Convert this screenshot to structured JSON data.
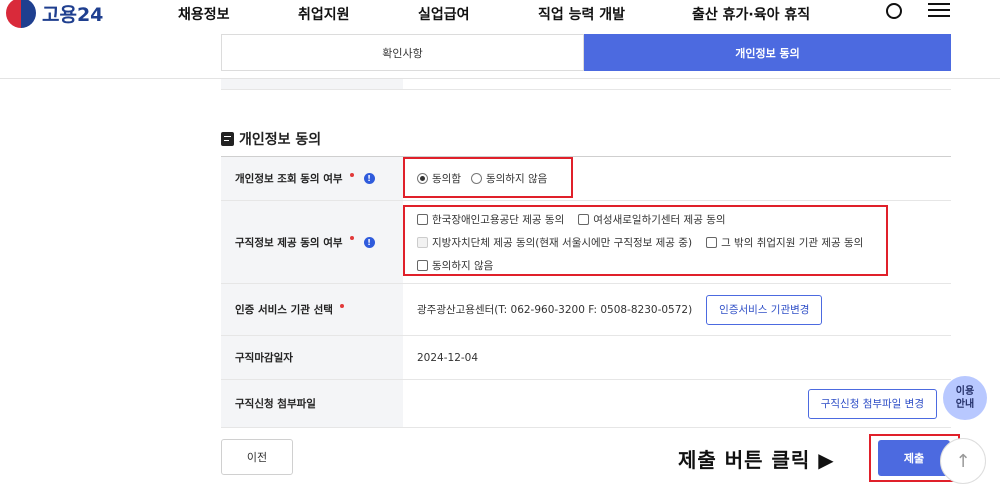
{
  "brand": {
    "name": "고용24"
  },
  "nav": {
    "items": [
      "채용정보",
      "취업지원",
      "실업급여",
      "직업 능력 개발",
      "출산 휴가·육아 휴직"
    ]
  },
  "tabs": [
    {
      "label": "확인사항",
      "active": false
    },
    {
      "label": "개인정보 동의",
      "active": true
    }
  ],
  "section": {
    "title": "개인정보 동의"
  },
  "form": {
    "privacy_consent": {
      "label": "개인정보 조회 동의 여부",
      "options": [
        "동의함",
        "동의하지 않음"
      ],
      "selected": "동의함"
    },
    "job_info_provide": {
      "label": "구직정보 제공 동의 여부",
      "options": [
        "한국장애인고용공단 제공 동의",
        "여성새로일하기센터 제공 동의",
        "지방자치단체 제공 동의(현재 서울시에만 구직정보 제공 중)",
        "그 밖의 취업지원 기관 제공 동의",
        "동의하지 않음"
      ]
    },
    "cert_service": {
      "label": "인증 서비스 기관 선택",
      "value": "광주광산고용센터(T: 062-960-3200 F: 0508-8230-0572)",
      "button": "인증서비스 기관변경"
    },
    "deadline": {
      "label": "구직마감일자",
      "value": "2024-12-04"
    },
    "attachment": {
      "label": "구직신청 첨부파일",
      "button": "구직신청 첨부파일 변경"
    }
  },
  "footer": {
    "prev": "이전",
    "submit": "제출",
    "annotation": "제출 버튼 클릭 ▶",
    "usage_line1": "이용",
    "usage_line2": "안내",
    "totop": "↑"
  },
  "colors": {
    "accent": "#4c6ae0",
    "highlight": "#e0202a",
    "required": "#e23a3a"
  }
}
